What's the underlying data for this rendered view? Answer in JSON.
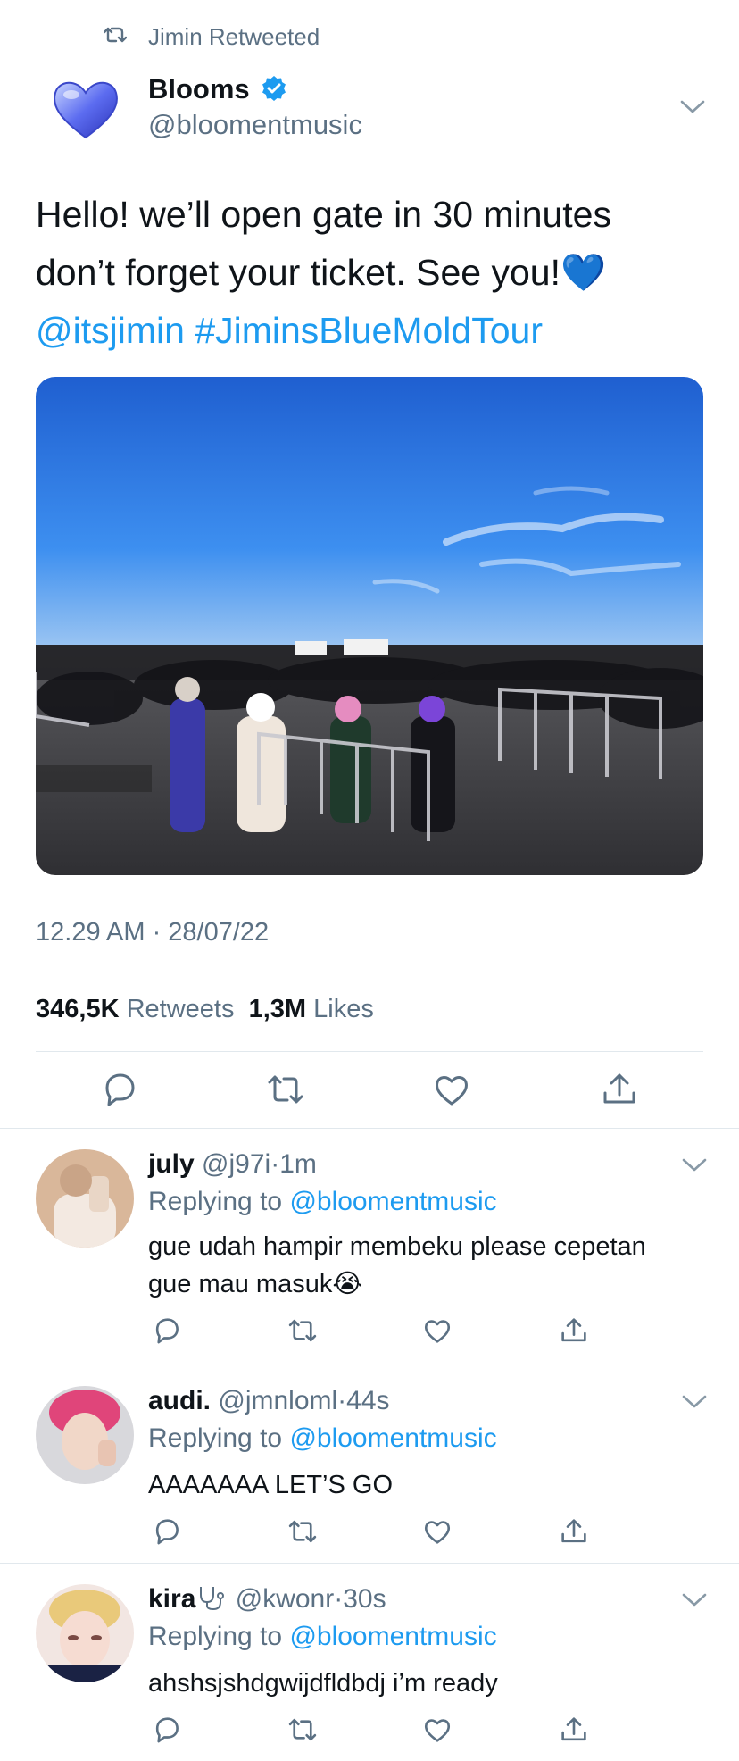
{
  "retweet_label": "Jimin Retweeted",
  "tweet": {
    "author_name": "Blooms",
    "author_handle": "@bloomentmusic",
    "text_line1": "Hello! we’ll open gate in 30 minutes",
    "text_line2": "don’t forget your ticket. See you!",
    "emoji_heart": "💙",
    "mention": "@itsjimin",
    "hashtag": "#JiminsBlueMoldTour",
    "timestamp": "12.29 AM · 28/07/22",
    "retweets_count": "346,5K",
    "retweets_label": "Retweets",
    "likes_count": "1,3M",
    "likes_label": "Likes"
  },
  "replies": [
    {
      "name": "july",
      "handle": "@j97i",
      "time": "1m",
      "replying_prefix": "Replying to",
      "replying_handle": "@bloomentmusic",
      "text": "gue udah hampir membeku please cepetan gue mau masuk😭"
    },
    {
      "name": "audi.",
      "handle": "@jmnloml",
      "time": "44s",
      "replying_prefix": "Replying to",
      "replying_handle": "@bloomentmusic",
      "text": "AAAAAAA LET’S GO"
    },
    {
      "name": "kira",
      "handle": "@kwonr",
      "time": "30s",
      "replying_prefix": "Replying to",
      "replying_handle": "@bloomentmusic",
      "text": "ahshsjshdgwijdfldbdj i’m ready"
    }
  ],
  "colors": {
    "accent": "#1d9bf0",
    "secondary_text": "#5b7083",
    "divider": "#e1e8ed"
  },
  "icons": [
    "retweet-icon",
    "verified-badge-icon",
    "chevron-down-icon",
    "reply-icon",
    "retweet-icon",
    "like-icon",
    "share-icon"
  ]
}
